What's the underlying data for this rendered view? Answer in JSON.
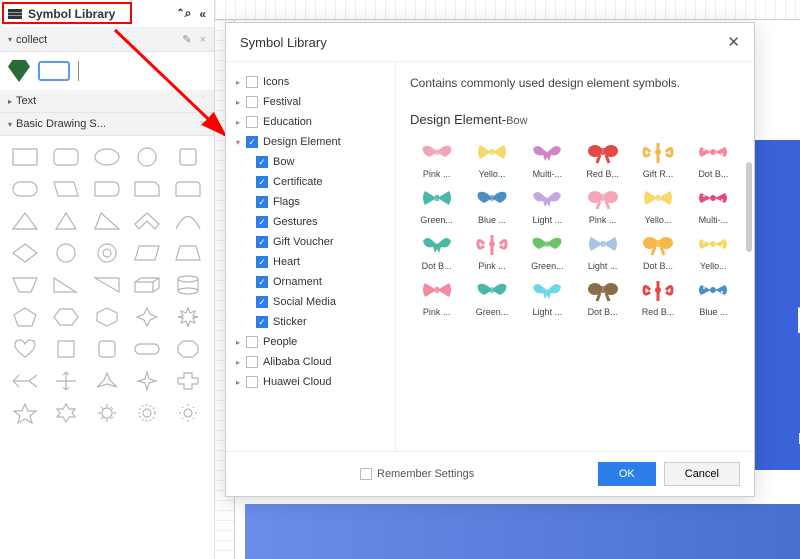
{
  "sidebar": {
    "title": "Symbol Library",
    "sections": {
      "collect": "collect",
      "text": "Text",
      "basic": "Basic Drawing S..."
    }
  },
  "dialog": {
    "title": "Symbol Library",
    "description": "Contains commonly used design element symbols.",
    "preview_title_main": "Design Element-",
    "preview_title_sub": "Bow",
    "remember": "Remember Settings",
    "ok": "OK",
    "cancel": "Cancel"
  },
  "tree": [
    {
      "label": "Icons",
      "checked": false,
      "expanded": false,
      "sub": false
    },
    {
      "label": "Festival",
      "checked": false,
      "expanded": false,
      "sub": false
    },
    {
      "label": "Education",
      "checked": false,
      "expanded": false,
      "sub": false
    },
    {
      "label": "Design Element",
      "checked": true,
      "expanded": true,
      "sub": false
    },
    {
      "label": "Bow",
      "checked": true,
      "sub": true
    },
    {
      "label": "Certificate",
      "checked": true,
      "sub": true
    },
    {
      "label": "Flags",
      "checked": true,
      "sub": true
    },
    {
      "label": "Gestures",
      "checked": true,
      "sub": true
    },
    {
      "label": "Gift Voucher",
      "checked": true,
      "sub": true
    },
    {
      "label": "Heart",
      "checked": true,
      "sub": true
    },
    {
      "label": "Ornament",
      "checked": true,
      "sub": true
    },
    {
      "label": "Social Media",
      "checked": true,
      "sub": true
    },
    {
      "label": "Sticker",
      "checked": true,
      "sub": true
    },
    {
      "label": "People",
      "checked": false,
      "expanded": false,
      "sub": false
    },
    {
      "label": "Alibaba Cloud",
      "checked": false,
      "expanded": false,
      "sub": false
    },
    {
      "label": "Huawei Cloud",
      "checked": false,
      "expanded": false,
      "sub": false
    }
  ],
  "previews": [
    {
      "label": "Pink ...",
      "color": "#f4a6b8",
      "type": "bow1"
    },
    {
      "label": "Yello...",
      "color": "#f5d96b",
      "type": "bow2"
    },
    {
      "label": "Multi-...",
      "color": "#d085c4",
      "type": "bow3"
    },
    {
      "label": "Red B...",
      "color": "#e24a4a",
      "type": "bow4"
    },
    {
      "label": "Gift R...",
      "color": "#f5b84a",
      "type": "bow5"
    },
    {
      "label": "Dot B...",
      "color": "#f48aa0",
      "type": "bow6"
    },
    {
      "label": "Green...",
      "color": "#4ab8a8",
      "type": "bow2"
    },
    {
      "label": "Blue ...",
      "color": "#4a8ec4",
      "type": "bow1"
    },
    {
      "label": "Light ...",
      "color": "#c4a8e4",
      "type": "bow3"
    },
    {
      "label": "Pink ...",
      "color": "#f4a6b8",
      "type": "bow4"
    },
    {
      "label": "Yello...",
      "color": "#f5d96b",
      "type": "bow2"
    },
    {
      "label": "Multi-...",
      "color": "#e24a8a",
      "type": "bow6"
    },
    {
      "label": "Dot B...",
      "color": "#4ab8a8",
      "type": "bow3"
    },
    {
      "label": "Pink ...",
      "color": "#f48aa0",
      "type": "bow5"
    },
    {
      "label": "Green...",
      "color": "#6bc46b",
      "type": "bow1"
    },
    {
      "label": "Light ...",
      "color": "#a8c4e4",
      "type": "bow2"
    },
    {
      "label": "Dot B...",
      "color": "#f5b84a",
      "type": "bow4"
    },
    {
      "label": "Yello...",
      "color": "#f5d96b",
      "type": "bow6"
    },
    {
      "label": "Pink ...",
      "color": "#f48aa0",
      "type": "bow2"
    },
    {
      "label": "Green...",
      "color": "#4ab8a8",
      "type": "bow1"
    },
    {
      "label": "Light ...",
      "color": "#6bd9e8",
      "type": "bow3"
    },
    {
      "label": "Dot B...",
      "color": "#8a6b4a",
      "type": "bow4"
    },
    {
      "label": "Red B...",
      "color": "#e24a4a",
      "type": "bow5"
    },
    {
      "label": "Blue ...",
      "color": "#4a8ec4",
      "type": "bow6"
    }
  ],
  "canvas_text": {
    "big": "nt",
    "small": "na"
  }
}
